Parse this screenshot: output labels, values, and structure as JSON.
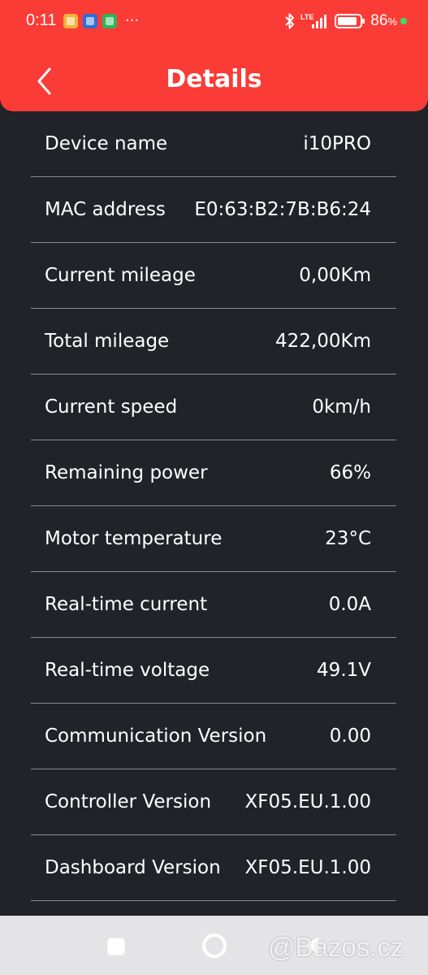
{
  "status_bar": {
    "time": "0:11",
    "more": "···",
    "network": "LTE",
    "battery_percent": "86",
    "battery_unit": "%"
  },
  "header": {
    "title": "Details"
  },
  "details": [
    {
      "label": "Device name",
      "value": "i10PRO"
    },
    {
      "label": "MAC address",
      "value": "E0:63:B2:7B:B6:24"
    },
    {
      "label": "Current mileage",
      "value": "0,00Km"
    },
    {
      "label": "Total mileage",
      "value": "422,00Km"
    },
    {
      "label": "Current speed",
      "value": "0km/h"
    },
    {
      "label": "Remaining power",
      "value": "66%"
    },
    {
      "label": "Motor temperature",
      "value": "23°C"
    },
    {
      "label": "Real-time current",
      "value": "0.0A"
    },
    {
      "label": "Real-time voltage",
      "value": "49.1V"
    },
    {
      "label": "Communication Version",
      "value": "0.00"
    },
    {
      "label": "Controller Version",
      "value": "XF05.EU.1.00"
    },
    {
      "label": "Dashboard Version",
      "value": "XF05.EU.1.00"
    }
  ],
  "watermark": "@Bazos.cz",
  "colors": {
    "header": "#fb3b36",
    "background": "#222328",
    "divider": "#8a8b90"
  },
  "icons": {
    "back": "chevron-left-icon",
    "bluetooth": "bluetooth-icon",
    "signal": "signal-icon",
    "battery": "battery-icon"
  }
}
